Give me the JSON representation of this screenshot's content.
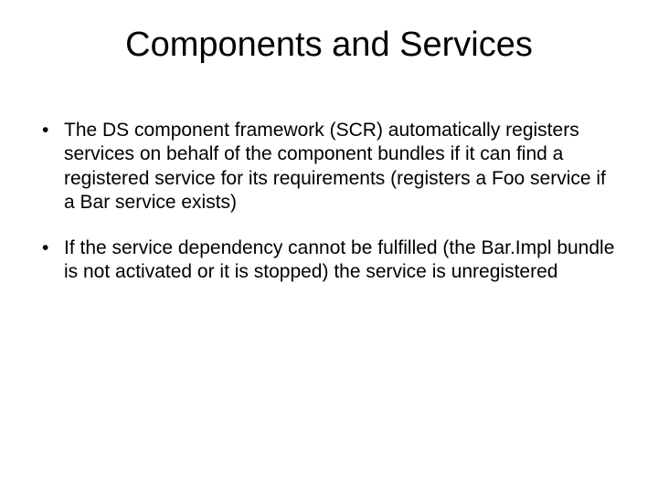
{
  "slide": {
    "title": "Components and Services",
    "bullets": [
      "The DS component framework (SCR) automatically registers services on behalf of the component bundles if it can find a registered service for its requirements (registers a Foo service if a Bar service exists)",
      "If the service dependency cannot be fulfilled (the Bar.Impl bundle is not activated or it is stopped) the service is unregistered"
    ]
  }
}
